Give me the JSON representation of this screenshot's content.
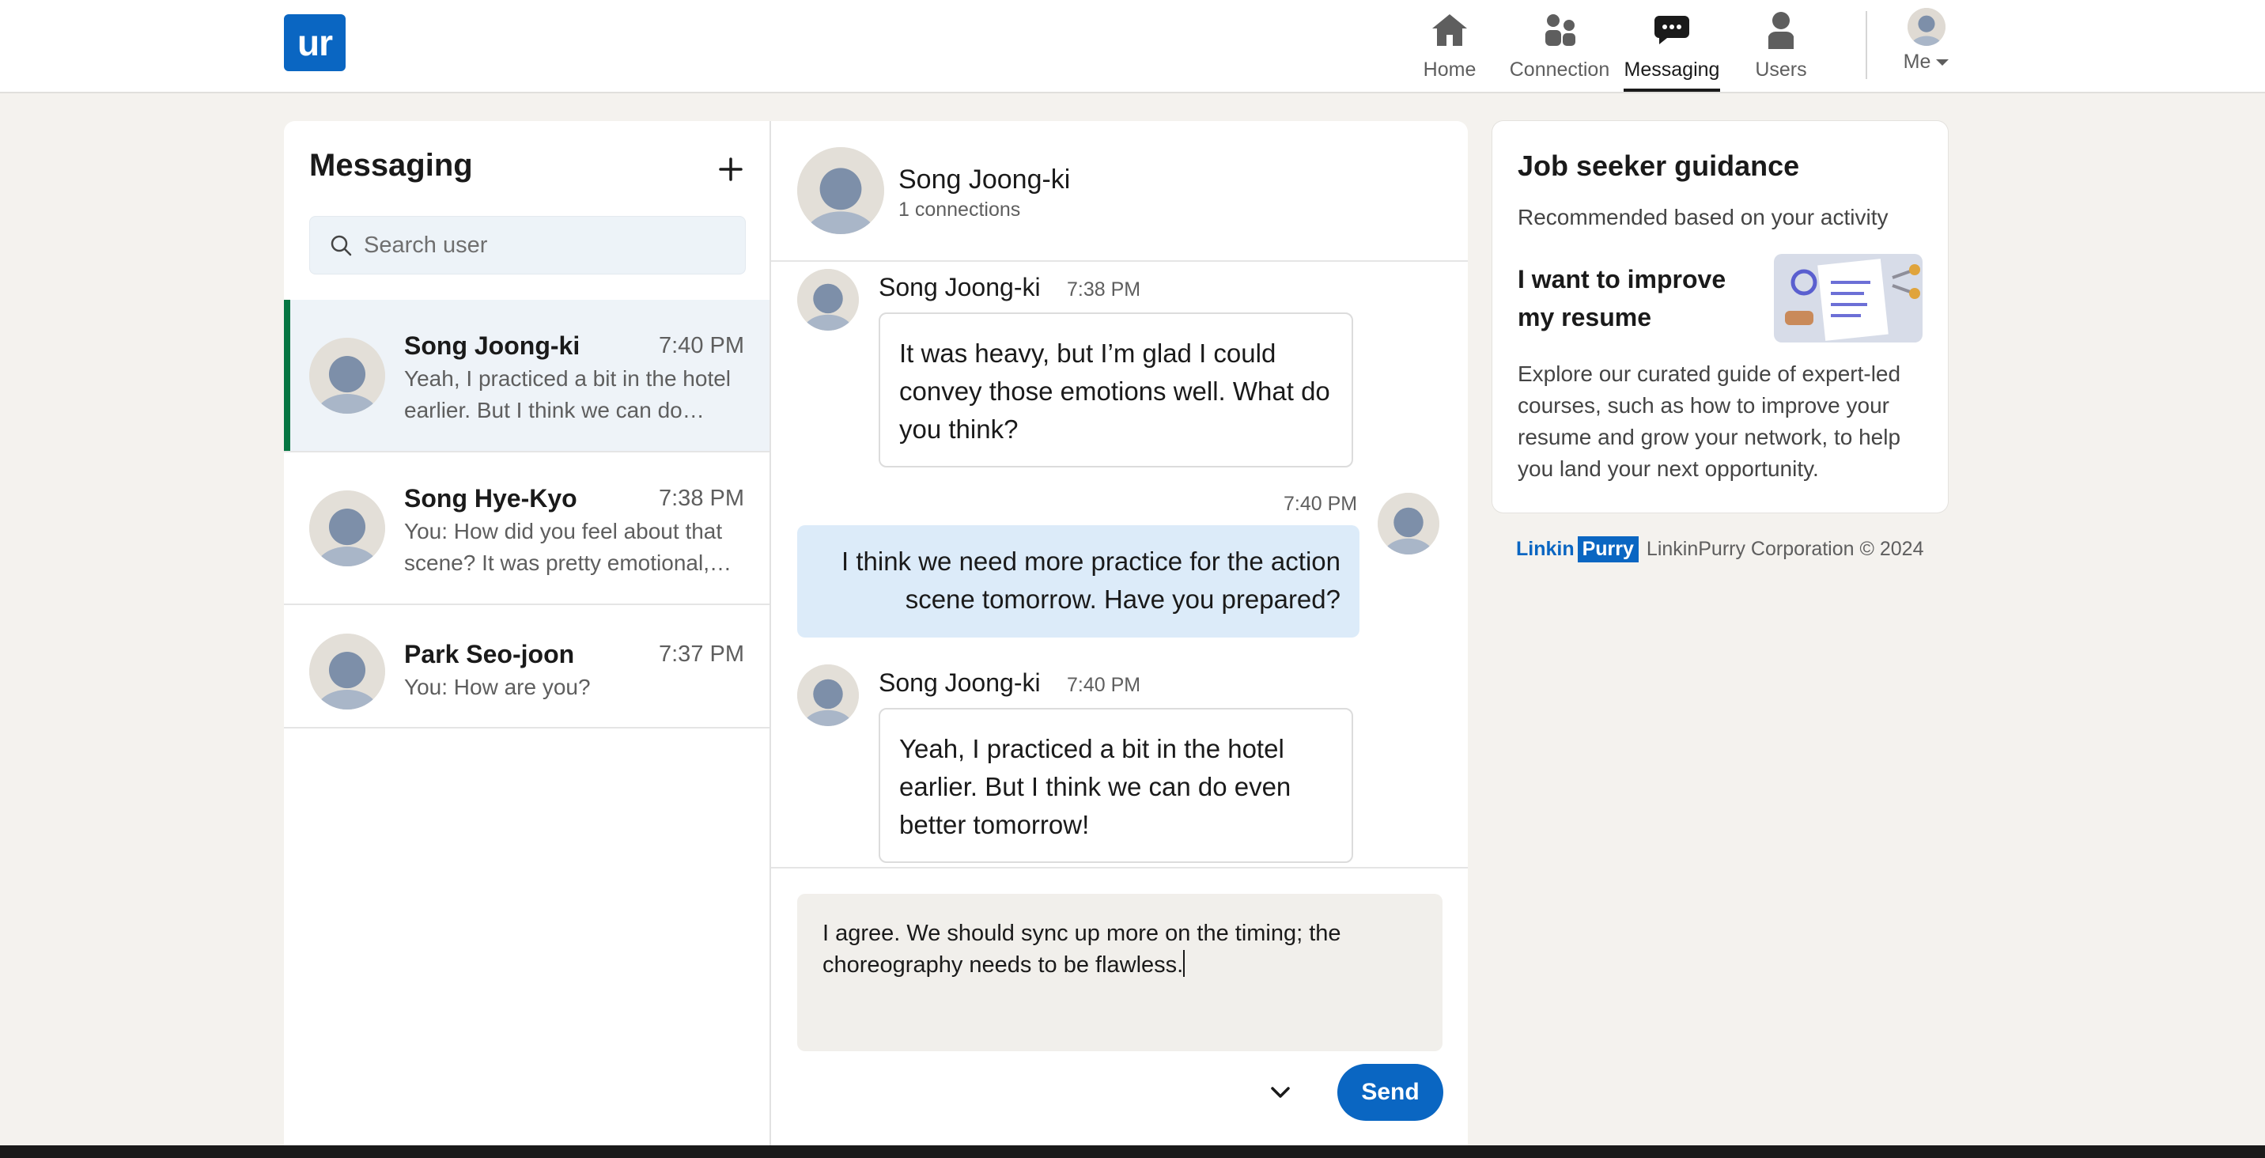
{
  "brand": {
    "logo_text": "ur",
    "accent": "#0a66c2"
  },
  "nav": {
    "items": [
      {
        "label": "Home",
        "icon": "home-icon"
      },
      {
        "label": "Connection",
        "icon": "people-icon"
      },
      {
        "label": "Messaging",
        "icon": "chat-bubble-icon",
        "active": true
      },
      {
        "label": "Users",
        "icon": "person-icon"
      }
    ],
    "me_label": "Me"
  },
  "sidebar": {
    "title": "Messaging",
    "search_placeholder": "Search user",
    "conversations": [
      {
        "name": "Song Joong-ki",
        "time": "7:40 PM",
        "preview": "Yeah, I practiced a bit in the hotel earlier. But I think we can do…",
        "active": true
      },
      {
        "name": "Song Hye-Kyo",
        "time": "7:38 PM",
        "preview": "You: How did you feel about that scene? It was pretty emotional,…"
      },
      {
        "name": "Park Seo-joon",
        "time": "7:37 PM",
        "preview": "You: How are you?"
      }
    ]
  },
  "chat": {
    "contact_name": "Song Joong-ki",
    "connections": "1 connections",
    "messages": [
      {
        "sender": "Song Joong-ki",
        "time": "7:38 PM",
        "text": "It was heavy, but I’m glad I could convey those emotions well. What do you think?",
        "outgoing": false
      },
      {
        "sender": "",
        "time": "7:40 PM",
        "text": "I think we need more practice for the action scene tomorrow. Have you prepared?",
        "outgoing": true
      },
      {
        "sender": "Song Joong-ki",
        "time": "7:40 PM",
        "text": "Yeah, I practiced a bit in the hotel earlier. But I think we can do even better tomorrow!",
        "outgoing": false
      }
    ],
    "composer_value": "I agree. We should sync up more on the timing; the choreography needs to be flawless.",
    "send_label": "Send"
  },
  "guidance": {
    "title": "Job seeker guidance",
    "subtitle": "Recommended based on your activity",
    "headline": "I want to improve my resume",
    "body": "Explore our curated guide of expert-led courses, such as how to improve your resume and grow your network, to help you land your next opportunity."
  },
  "footer": {
    "logo_part1": "Linkin",
    "logo_part2": "Purry",
    "copyright": "LinkinPurry Corporation © 2024"
  }
}
